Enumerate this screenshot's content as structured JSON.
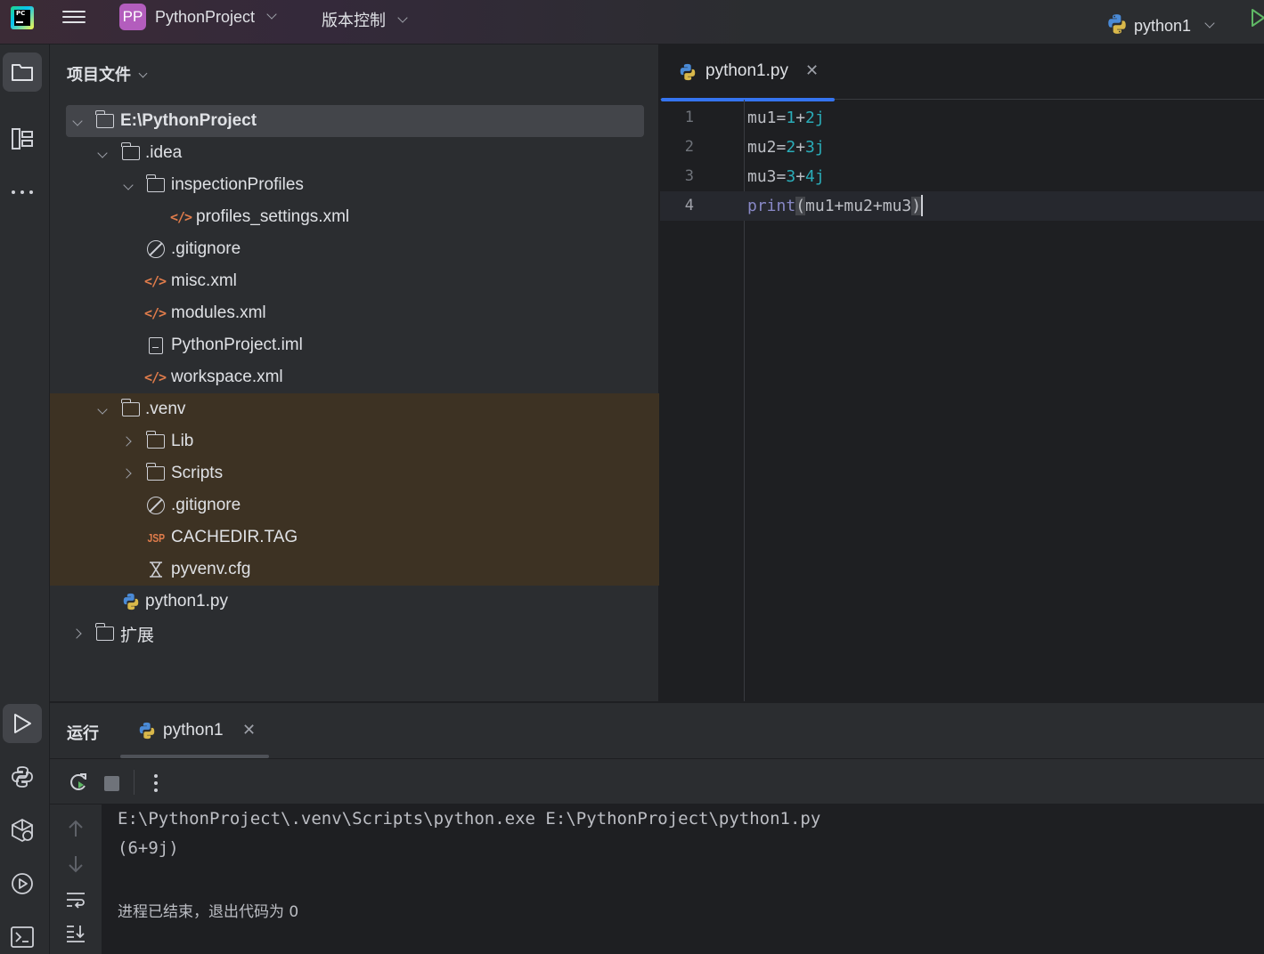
{
  "titlebar": {
    "app_logo_text": "PC",
    "project_badge": "PP",
    "project_name": "PythonProject",
    "vcs_label": "版本控制",
    "run_config": "python1"
  },
  "project_panel": {
    "title": "项目文件",
    "tree": [
      {
        "label": "E:\\PythonProject",
        "icon": "folder-icon",
        "expanded": true,
        "selected": true
      },
      {
        "label": ".idea",
        "icon": "folder-icon",
        "expanded": true
      },
      {
        "label": "inspectionProfiles",
        "icon": "folder-icon",
        "expanded": true
      },
      {
        "label": "profiles_settings.xml",
        "icon": "xml-file-icon"
      },
      {
        "label": ".gitignore",
        "icon": "ignore-file-icon"
      },
      {
        "label": "misc.xml",
        "icon": "xml-file-icon"
      },
      {
        "label": "modules.xml",
        "icon": "xml-file-icon"
      },
      {
        "label": "PythonProject.iml",
        "icon": "iml-file-icon"
      },
      {
        "label": "workspace.xml",
        "icon": "xml-file-icon"
      },
      {
        "label": ".venv",
        "icon": "folder-icon",
        "expanded": true,
        "excluded": true
      },
      {
        "label": "Lib",
        "icon": "folder-icon",
        "expanded": false,
        "excluded": true
      },
      {
        "label": "Scripts",
        "icon": "folder-icon",
        "expanded": false,
        "excluded": true
      },
      {
        "label": ".gitignore",
        "icon": "ignore-file-icon",
        "excluded": true
      },
      {
        "label": "CACHEDIR.TAG",
        "icon": "jsp-file-icon",
        "icon_text": "JSP",
        "excluded": true
      },
      {
        "label": "pyvenv.cfg",
        "icon": "config-file-icon",
        "excluded": true
      },
      {
        "label": "python1.py",
        "icon": "python-file-icon"
      },
      {
        "label": "扩展",
        "icon": "folder-icon",
        "expanded": false
      }
    ]
  },
  "editor": {
    "tab_label": "python1.py",
    "lines": [
      {
        "n": "1",
        "parts": [
          [
            "t",
            "mu1="
          ],
          [
            "num",
            "1"
          ],
          [
            "t",
            "+"
          ],
          [
            "num",
            "2j"
          ]
        ]
      },
      {
        "n": "2",
        "parts": [
          [
            "t",
            "mu2="
          ],
          [
            "num",
            "2"
          ],
          [
            "t",
            "+"
          ],
          [
            "num",
            "3j"
          ]
        ]
      },
      {
        "n": "3",
        "parts": [
          [
            "t",
            "mu3="
          ],
          [
            "num",
            "3"
          ],
          [
            "t",
            "+"
          ],
          [
            "num",
            "4j"
          ]
        ]
      },
      {
        "n": "4",
        "parts": [
          [
            "builtin",
            "print"
          ],
          [
            "hl",
            "("
          ],
          [
            "t",
            "mu1+mu2+mu3"
          ],
          [
            "hl",
            ")"
          ]
        ],
        "current": true
      }
    ]
  },
  "run_panel": {
    "title": "运行",
    "tab_label": "python1",
    "console": [
      "E:\\PythonProject\\.venv\\Scripts\\python.exe E:\\PythonProject\\python1.py",
      "(6+9j)",
      "",
      "进程已结束，退出代码为 0"
    ]
  },
  "colors": {
    "accent": "#3574f0",
    "number": "#2aacb8",
    "builtin": "#8888c6",
    "xml_icon": "#e07c4b",
    "project_badge": "#b35dbd",
    "excluded_bg": "#3d3223"
  }
}
